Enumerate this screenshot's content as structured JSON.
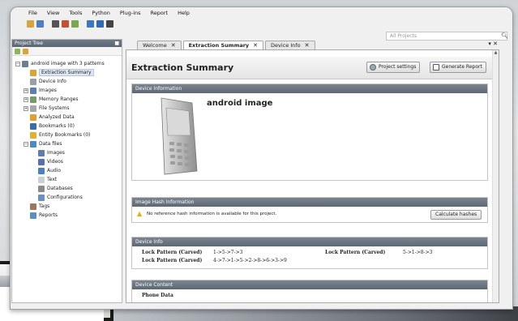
{
  "menu": [
    "File",
    "View",
    "Tools",
    "Python",
    "Plug-ins",
    "Report",
    "Help"
  ],
  "search": {
    "placeholder": "All Projects"
  },
  "project_tree": {
    "title": "Project Tree",
    "items": [
      {
        "label": "android image with 3 patterns",
        "level": 0,
        "expander": "−",
        "icon": "drive-icon"
      },
      {
        "label": "Extraction Summary",
        "level": 1,
        "icon": "summary-icon",
        "selected": true
      },
      {
        "label": "Device Info",
        "level": 1,
        "icon": "device-info-icon"
      },
      {
        "label": "Images",
        "level": 1,
        "expander": "+",
        "icon": "images-icon"
      },
      {
        "label": "Memory Ranges",
        "level": 1,
        "expander": "+",
        "icon": "memory-icon"
      },
      {
        "label": "File Systems",
        "level": 1,
        "expander": "+",
        "icon": "filesystem-icon"
      },
      {
        "label": "Analyzed Data",
        "level": 1,
        "icon": "analyzed-data-icon"
      },
      {
        "label": "Bookmarks (0)",
        "level": 1,
        "icon": "bookmarks-icon"
      },
      {
        "label": "Entity Bookmarks (0)",
        "level": 1,
        "icon": "entity-bookmarks-icon"
      },
      {
        "label": "Data files",
        "level": 1,
        "expander": "−",
        "icon": "data-files-icon"
      },
      {
        "label": "Images",
        "level": 2,
        "icon": "images-icon"
      },
      {
        "label": "Videos",
        "level": 2,
        "icon": "videos-icon"
      },
      {
        "label": "Audio",
        "level": 2,
        "icon": "audio-icon"
      },
      {
        "label": "Text",
        "level": 2,
        "icon": "text-icon"
      },
      {
        "label": "Databases",
        "level": 2,
        "icon": "database-icon"
      },
      {
        "label": "Configurations",
        "level": 2,
        "icon": "config-icon"
      },
      {
        "label": "Tags",
        "level": 1,
        "icon": "tags-icon"
      },
      {
        "label": "Reports",
        "level": 1,
        "icon": "reports-icon"
      }
    ]
  },
  "tabs": [
    {
      "label": "Welcome",
      "active": false
    },
    {
      "label": "Extraction Summary",
      "active": true
    },
    {
      "label": "Device Info",
      "active": false
    }
  ],
  "content": {
    "title": "Extraction Summary",
    "project_settings_label": "Project settings",
    "generate_report_label": "Generate Report",
    "device_info_section": {
      "header": "Device Information",
      "device_name": "android image"
    },
    "hash_section": {
      "header": "Image Hash Information",
      "message": "No reference hash information is available for this project.",
      "button": "Calculate hashes"
    },
    "device_info2": {
      "header": "Device Info",
      "rows": [
        {
          "label": "Lock Pattern (Carved)",
          "value": "1->5->7->3"
        },
        {
          "label": "Lock Pattern (Carved)",
          "value": "4->7->1->5->2->8->6->3->9"
        },
        {
          "label": "Lock Pattern (Carved)",
          "value": "5->1->8->3"
        }
      ]
    },
    "device_content": {
      "header": "Device Content",
      "first_row": "Phone Data"
    }
  },
  "colors": {
    "panel_header": "#5d6873",
    "selection": "#dde6f2",
    "warning": "#e8b000"
  }
}
